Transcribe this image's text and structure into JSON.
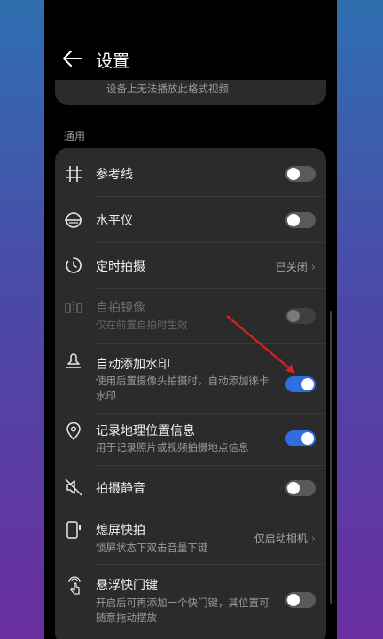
{
  "header": {
    "title": "设置",
    "back_icon": "arrow-left-icon"
  },
  "top_card": {
    "text": "设备上无法播放此格式视频"
  },
  "section": {
    "label": "通用"
  },
  "settings": {
    "gridline": {
      "label": "参考线",
      "icon": "grid-icon",
      "enabled": false
    },
    "level": {
      "label": "水平仪",
      "icon": "level-icon",
      "enabled": false
    },
    "timer": {
      "label": "定时拍摄",
      "icon": "timer-icon",
      "value": "已关闭"
    },
    "mirror": {
      "label": "自拍镜像",
      "desc": "仅在前置自拍时生效",
      "icon": "mirror-icon",
      "enabled": false,
      "disabled": true
    },
    "watermark": {
      "label": "自动添加水印",
      "desc": "使用后置摄像头拍摄时，自动添加徕卡水印",
      "icon": "stamp-icon",
      "enabled": true
    },
    "location": {
      "label": "记录地理位置信息",
      "desc": "用于记录照片或视频拍摄地点信息",
      "icon": "location-pin-icon",
      "enabled": true
    },
    "mute": {
      "label": "拍摄静音",
      "icon": "speaker-mute-icon",
      "enabled": false
    },
    "quick_snap": {
      "label": "熄屏快拍",
      "desc": "锁屏状态下双击音量下键",
      "icon": "phone-side-button-icon",
      "value": "仅启动相机"
    },
    "floating_shutter": {
      "label": "悬浮快门键",
      "desc": "开启后可再添加一个快门键，其位置可随意拖动摆放",
      "icon": "touch-finger-icon",
      "enabled": false
    }
  },
  "colors": {
    "accent": "#2f6de0",
    "card": "#2b2b2b",
    "annotation_arrow": "#e02020"
  }
}
